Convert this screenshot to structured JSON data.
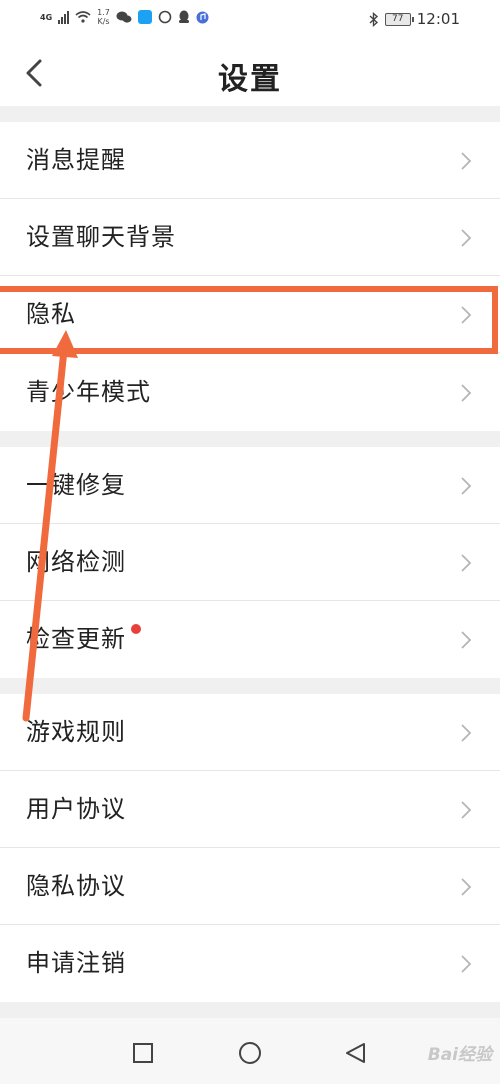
{
  "status_bar": {
    "network": "4G",
    "speed_value": "1.7",
    "speed_unit": "K/s",
    "battery": "77",
    "time": "12:01"
  },
  "header": {
    "title": "设置"
  },
  "settings": {
    "items": [
      {
        "label": "消息提醒"
      },
      {
        "label": "设置聊天背景"
      },
      {
        "label": "隐私"
      },
      {
        "label": "青少年模式"
      },
      {
        "label": "一键修复"
      },
      {
        "label": "网络检测"
      },
      {
        "label": "检查更新"
      },
      {
        "label": "游戏规则"
      },
      {
        "label": "用户协议"
      },
      {
        "label": "隐私协议"
      },
      {
        "label": "申请注销"
      }
    ]
  },
  "watermark": {
    "text": "Bai经验"
  },
  "colors": {
    "annotation": "#f06a3d",
    "badge": "#e8413b",
    "section_gap": "#f0f0f0"
  }
}
